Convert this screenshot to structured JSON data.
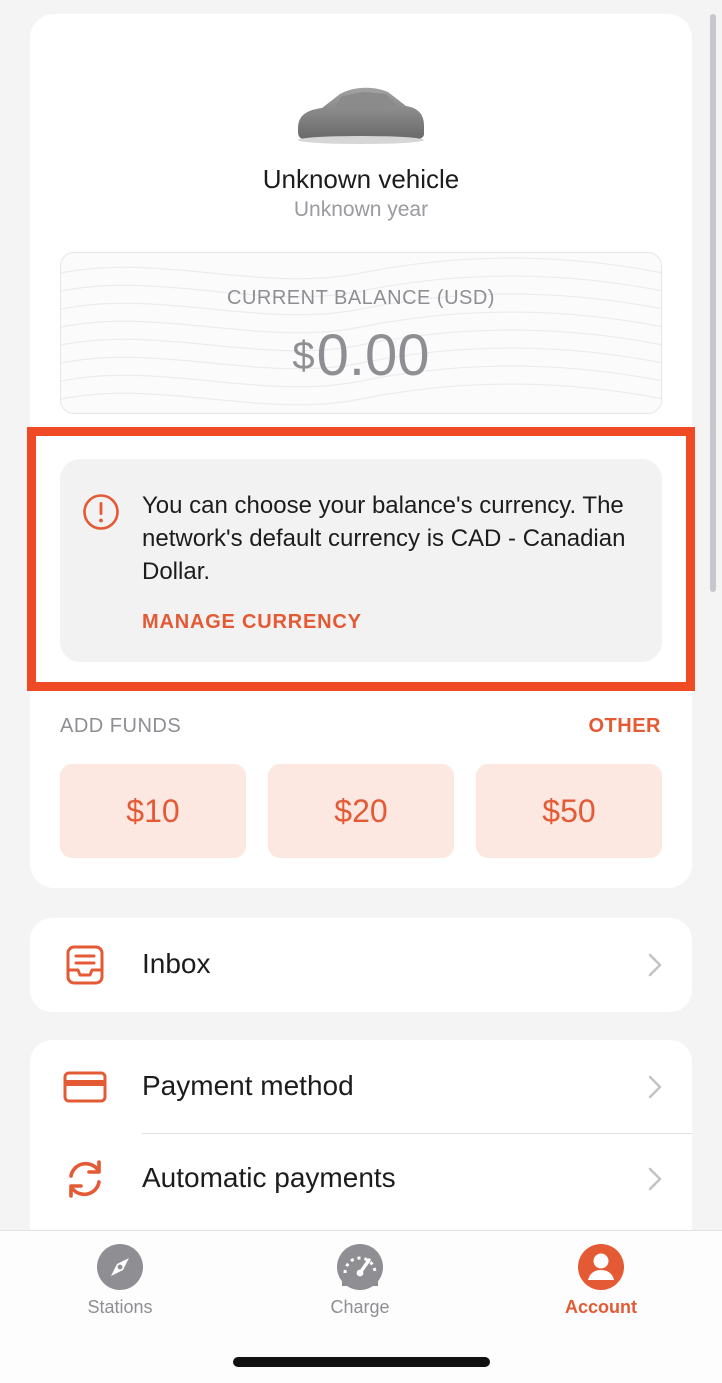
{
  "vehicle": {
    "name": "Unknown vehicle",
    "year": "Unknown year"
  },
  "balance": {
    "label": "CURRENT BALANCE (USD)",
    "currency_symbol": "$",
    "amount": "0.00"
  },
  "notice": {
    "icon": "info-icon",
    "text": "You can choose your balance's currency. The network's default currency is CAD - Canadian Dollar.",
    "link_label": "MANAGE CURRENCY"
  },
  "funds": {
    "label": "ADD FUNDS",
    "other_label": "OTHER",
    "options": [
      "$10",
      "$20",
      "$50"
    ]
  },
  "menu": {
    "inbox": {
      "label": "Inbox",
      "icon": "inbox-icon"
    },
    "payment_method": {
      "label": "Payment method",
      "icon": "credit-card-icon"
    },
    "automatic_payments": {
      "label": "Automatic payments",
      "icon": "refresh-icon"
    }
  },
  "tabs": [
    {
      "label": "Stations",
      "icon": "compass-icon",
      "active": false
    },
    {
      "label": "Charge",
      "icon": "gauge-icon",
      "active": false
    },
    {
      "label": "Account",
      "icon": "user-icon",
      "active": true
    }
  ],
  "colors": {
    "accent": "#e35a35",
    "highlight": "#f04a25",
    "fund_button_bg": "#fde7e1",
    "inactive_tab": "#8e8e93"
  }
}
